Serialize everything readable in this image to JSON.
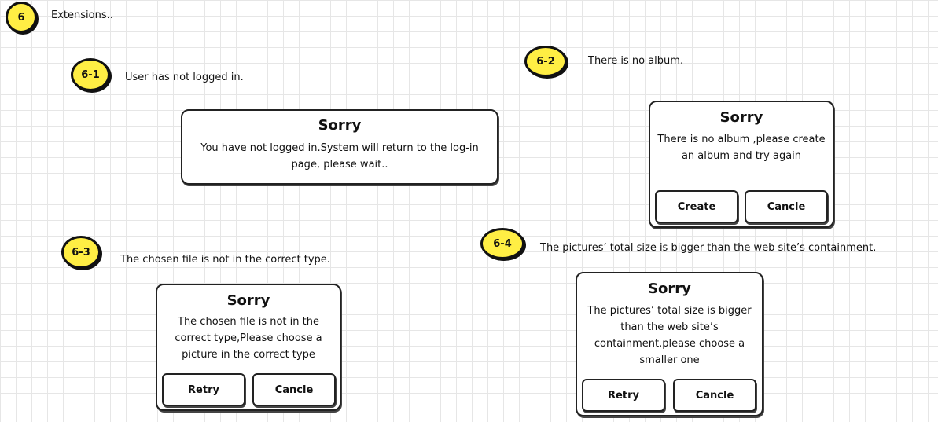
{
  "header": {
    "badge": "6",
    "title": "Extensions.."
  },
  "scenarios": {
    "s61": {
      "badge": "6-1",
      "note": "User has not logged in.",
      "dialog": {
        "title": "Sorry",
        "message": "You have not logged in.System will return to the log-in page, please wait.."
      }
    },
    "s62": {
      "badge": "6-2",
      "note": "There is no album.",
      "dialog": {
        "title": "Sorry",
        "message": "There is no album ,please create an album and try again",
        "buttons": [
          "Create",
          "Cancle"
        ]
      }
    },
    "s63": {
      "badge": "6-3",
      "note": "The chosen file is not in the correct type.",
      "dialog": {
        "title": "Sorry",
        "message": "The chosen file is not in the correct type,Please choose a picture in the correct type",
        "buttons": [
          "Retry",
          "Cancle"
        ]
      }
    },
    "s64": {
      "badge": "6-4",
      "note": "The pictures’ total size is bigger than the web site’s containment.",
      "dialog": {
        "title": "Sorry",
        "message": "The pictures’ total size is bigger than the web site’s containment.please choose a smaller one",
        "buttons": [
          "Retry",
          "Cancle"
        ]
      }
    }
  },
  "colors": {
    "badge_fill": "#ffee44",
    "outline": "#222222",
    "grid": "#e6e6e6"
  }
}
